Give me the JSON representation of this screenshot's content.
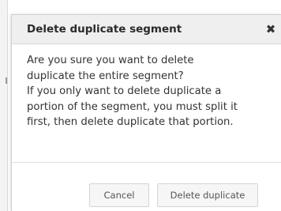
{
  "dialog": {
    "title": "Delete duplicate segment",
    "close_icon": "close-icon",
    "body_lines": [
      "Are you sure you want to delete",
      "duplicate the entire segment?",
      "If you only want to delete duplicate a",
      "portion of the segment, you must split it",
      "first, then delete duplicate that portion."
    ],
    "buttons": {
      "cancel_label": "Cancel",
      "delete_label": "Delete duplicate"
    }
  },
  "colors": {
    "header_bg": "#efefef",
    "button_bg": "#f6f6f6",
    "text": "#333333"
  }
}
